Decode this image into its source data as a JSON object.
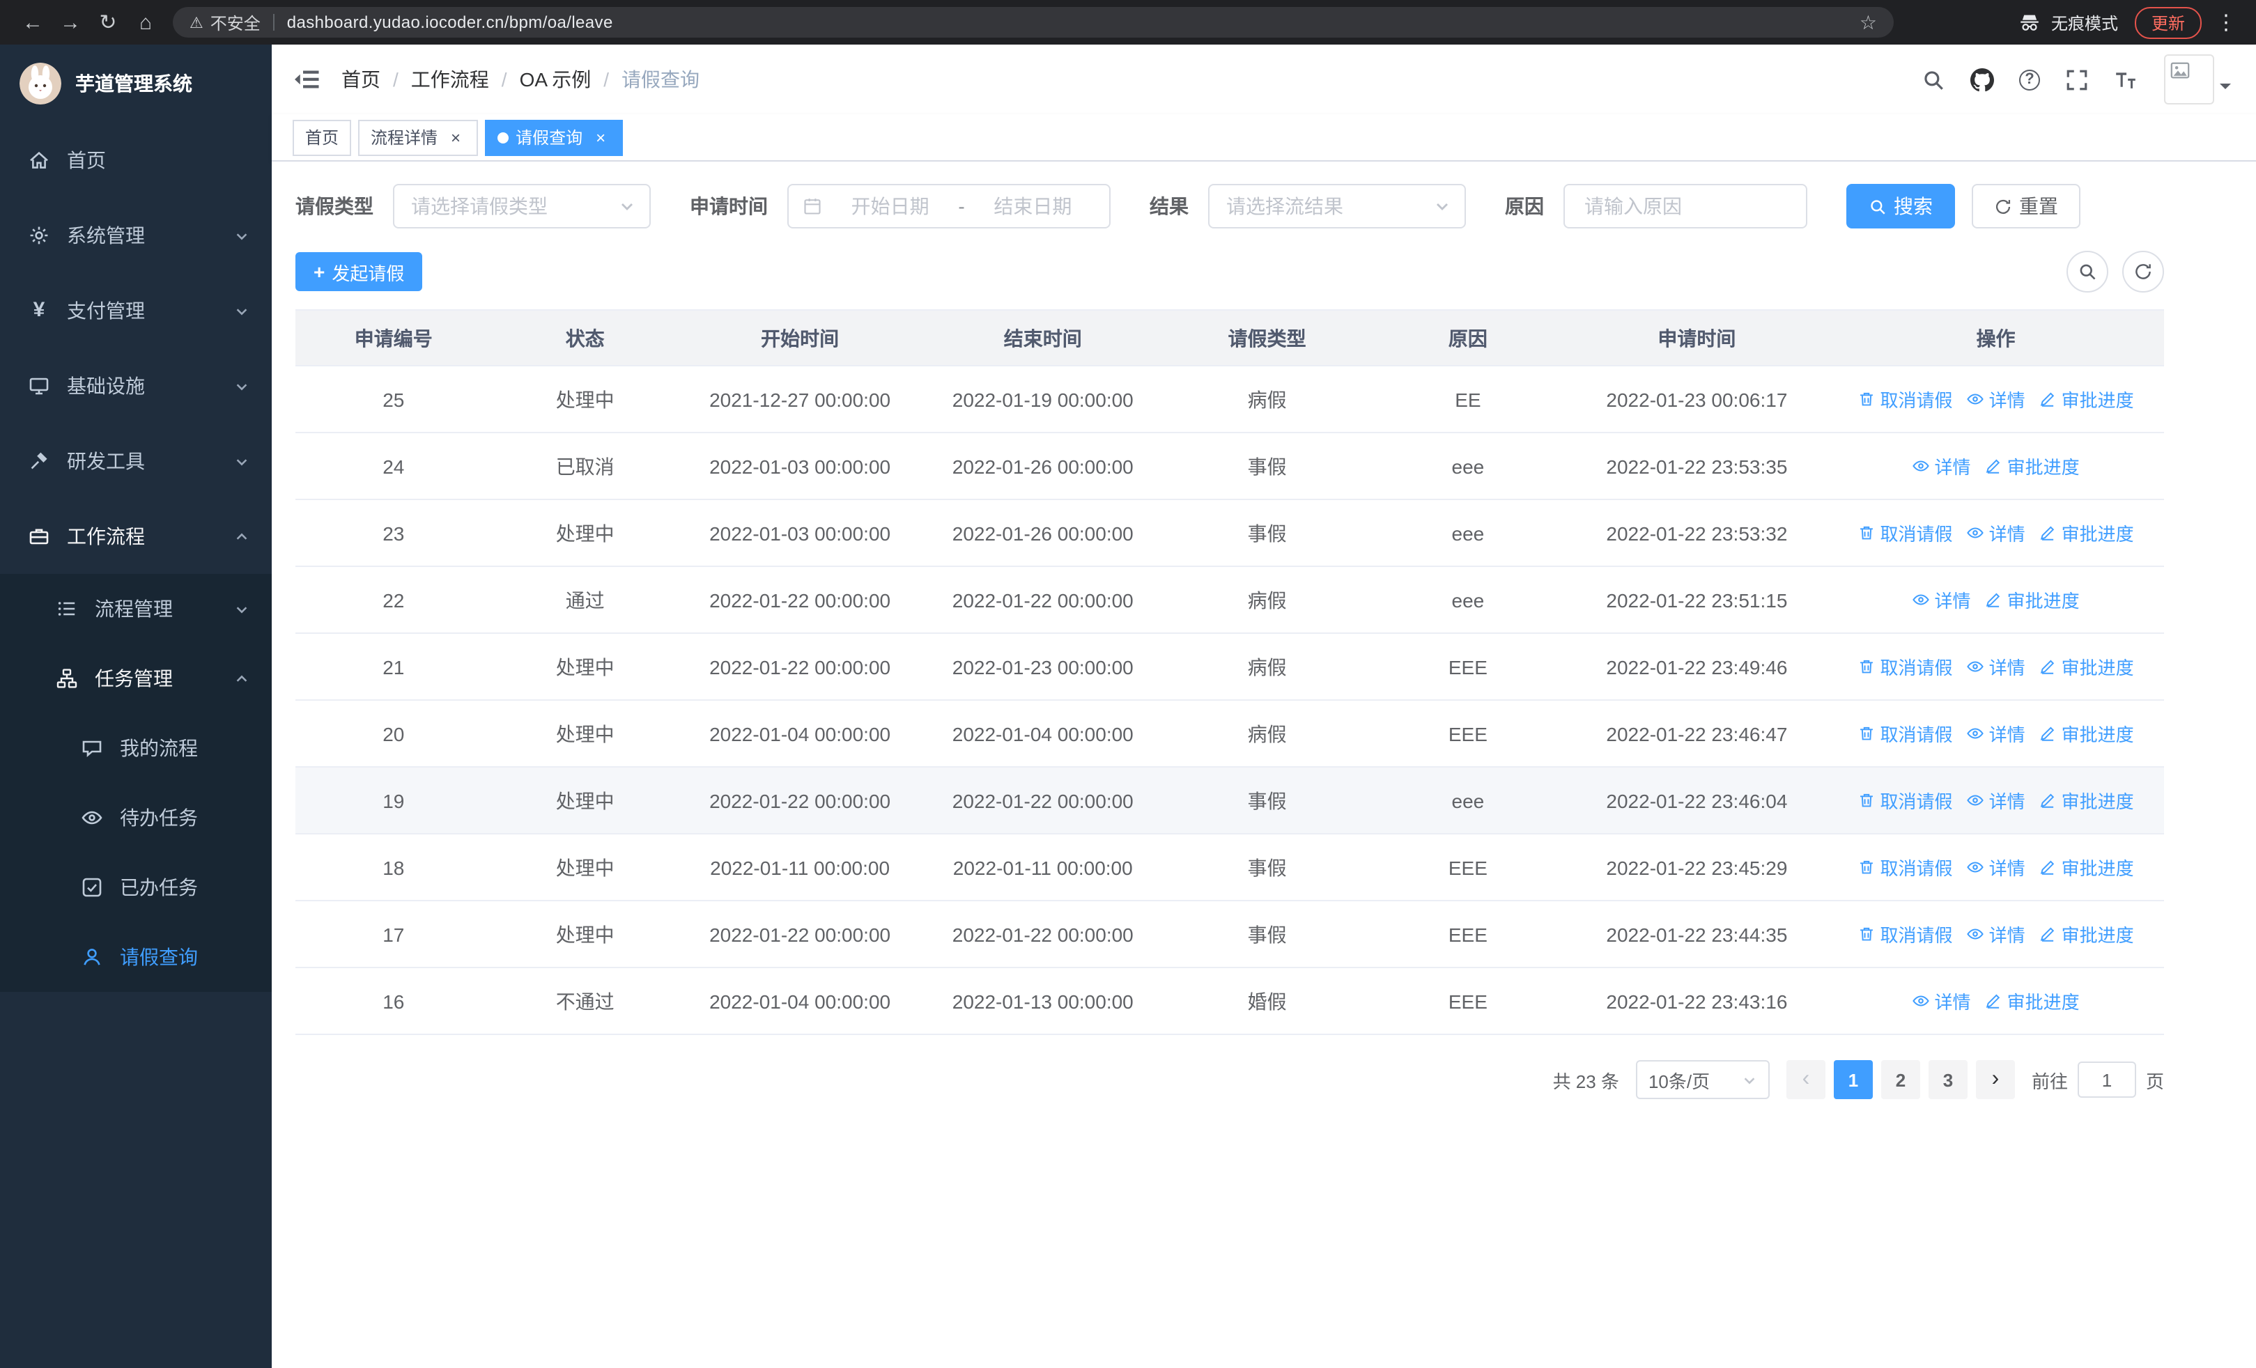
{
  "browser": {
    "security_label": "不安全",
    "url": "dashboard.yudao.iocoder.cn/bpm/oa/leave",
    "incognito_label": "无痕模式",
    "update_label": "更新"
  },
  "sidebar": {
    "logo_title": "芋道管理系统",
    "items": [
      {
        "label": "首页",
        "icon": "home-icon"
      },
      {
        "label": "系统管理",
        "icon": "gear-icon",
        "chevron": "down"
      },
      {
        "label": "支付管理",
        "icon": "yen-icon",
        "chevron": "down"
      },
      {
        "label": "基础设施",
        "icon": "monitor-icon",
        "chevron": "down"
      },
      {
        "label": "研发工具",
        "icon": "tool-icon",
        "chevron": "down"
      },
      {
        "label": "工作流程",
        "icon": "briefcase-icon",
        "chevron": "up",
        "expanded": true,
        "children": [
          {
            "label": "流程管理",
            "icon": "list-icon",
            "chevron": "down"
          },
          {
            "label": "任务管理",
            "icon": "tree-icon",
            "chevron": "up",
            "expanded": true,
            "children": [
              {
                "label": "我的流程",
                "icon": "chat-icon"
              },
              {
                "label": "待办任务",
                "icon": "eye-icon"
              },
              {
                "label": "已办任务",
                "icon": "check-icon"
              },
              {
                "label": "请假查询",
                "icon": "user-icon",
                "active": true
              }
            ]
          }
        ]
      }
    ]
  },
  "header": {
    "breadcrumb": [
      "首页",
      "工作流程",
      "OA 示例",
      "请假查询"
    ]
  },
  "tabs": [
    {
      "label": "首页"
    },
    {
      "label": "流程详情",
      "closable": true
    },
    {
      "label": "请假查询",
      "closable": true,
      "active": true
    }
  ],
  "filters": {
    "leave_type_label": "请假类型",
    "leave_type_placeholder": "请选择请假类型",
    "apply_time_label": "申请时间",
    "start_date_placeholder": "开始日期",
    "range_separator": "-",
    "end_date_placeholder": "结束日期",
    "result_label": "结果",
    "result_placeholder": "请选择流结果",
    "reason_label": "原因",
    "reason_placeholder": "请输入原因",
    "search_label": "搜索",
    "reset_label": "重置"
  },
  "toolbar": {
    "create_label": "发起请假"
  },
  "table": {
    "headers": [
      "申请编号",
      "状态",
      "开始时间",
      "结束时间",
      "请假类型",
      "原因",
      "申请时间",
      "操作"
    ],
    "actions": {
      "cancel": "取消请假",
      "detail": "详情",
      "progress": "审批进度"
    },
    "rows": [
      {
        "id": "25",
        "status": "处理中",
        "start": "2021-12-27 00:00:00",
        "end": "2022-01-19 00:00:00",
        "type": "病假",
        "reason": "EE",
        "apply_time": "2022-01-23 00:06:17",
        "can_cancel": true,
        "highlight": false
      },
      {
        "id": "24",
        "status": "已取消",
        "start": "2022-01-03 00:00:00",
        "end": "2022-01-26 00:00:00",
        "type": "事假",
        "reason": "eee",
        "apply_time": "2022-01-22 23:53:35",
        "can_cancel": false,
        "highlight": false
      },
      {
        "id": "23",
        "status": "处理中",
        "start": "2022-01-03 00:00:00",
        "end": "2022-01-26 00:00:00",
        "type": "事假",
        "reason": "eee",
        "apply_time": "2022-01-22 23:53:32",
        "can_cancel": true,
        "highlight": false
      },
      {
        "id": "22",
        "status": "通过",
        "start": "2022-01-22 00:00:00",
        "end": "2022-01-22 00:00:00",
        "type": "病假",
        "reason": "eee",
        "apply_time": "2022-01-22 23:51:15",
        "can_cancel": false,
        "highlight": false
      },
      {
        "id": "21",
        "status": "处理中",
        "start": "2022-01-22 00:00:00",
        "end": "2022-01-23 00:00:00",
        "type": "病假",
        "reason": "EEE",
        "apply_time": "2022-01-22 23:49:46",
        "can_cancel": true,
        "highlight": false
      },
      {
        "id": "20",
        "status": "处理中",
        "start": "2022-01-04 00:00:00",
        "end": "2022-01-04 00:00:00",
        "type": "病假",
        "reason": "EEE",
        "apply_time": "2022-01-22 23:46:47",
        "can_cancel": true,
        "highlight": false
      },
      {
        "id": "19",
        "status": "处理中",
        "start": "2022-01-22 00:00:00",
        "end": "2022-01-22 00:00:00",
        "type": "事假",
        "reason": "eee",
        "apply_time": "2022-01-22 23:46:04",
        "can_cancel": true,
        "highlight": true
      },
      {
        "id": "18",
        "status": "处理中",
        "start": "2022-01-11 00:00:00",
        "end": "2022-01-11 00:00:00",
        "type": "事假",
        "reason": "EEE",
        "apply_time": "2022-01-22 23:45:29",
        "can_cancel": true,
        "highlight": false
      },
      {
        "id": "17",
        "status": "处理中",
        "start": "2022-01-22 00:00:00",
        "end": "2022-01-22 00:00:00",
        "type": "事假",
        "reason": "EEE",
        "apply_time": "2022-01-22 23:44:35",
        "can_cancel": true,
        "highlight": false
      },
      {
        "id": "16",
        "status": "不通过",
        "start": "2022-01-04 00:00:00",
        "end": "2022-01-13 00:00:00",
        "type": "婚假",
        "reason": "EEE",
        "apply_time": "2022-01-22 23:43:16",
        "can_cancel": false,
        "highlight": false
      }
    ]
  },
  "pagination": {
    "total": "共 23 条",
    "page_size": "10条/页",
    "pages": [
      "1",
      "2",
      "3"
    ],
    "active_page": "1",
    "goto_label": "前往",
    "goto_value": "1",
    "page_label": "页"
  }
}
